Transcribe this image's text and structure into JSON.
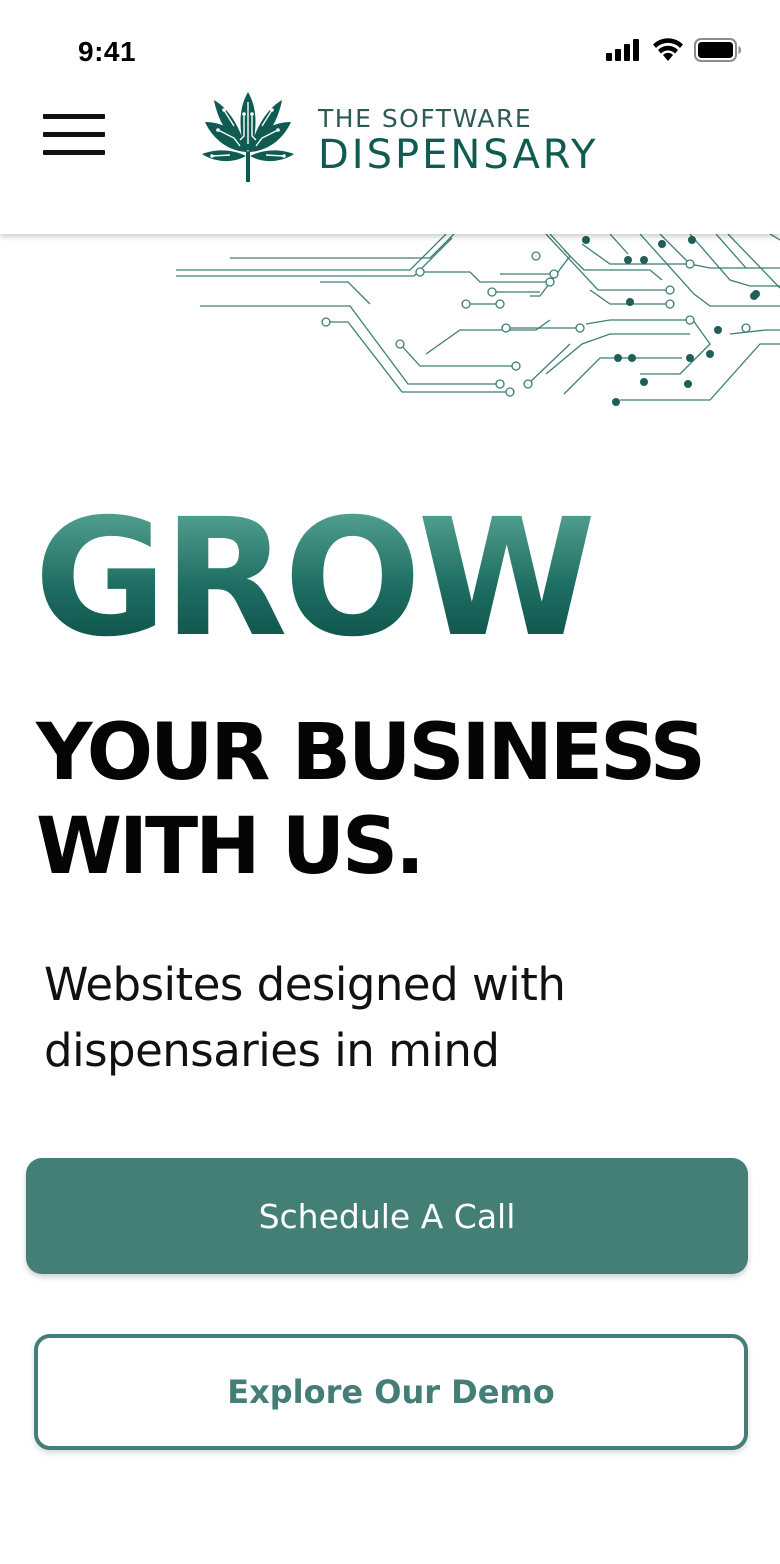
{
  "status_bar": {
    "time": "9:41"
  },
  "header": {
    "menu_icon": "hamburger-menu-icon",
    "logo_icon": "cannabis-leaf-circuit-icon",
    "logo_line1": "THE SOFTWARE",
    "logo_line2": "DISPENSARY"
  },
  "hero": {
    "decoration_icon": "circuit-lines-decoration",
    "grow": "GROW",
    "headline_line1": "YOUR BUSINESS",
    "headline_line2": "WITH US.",
    "subtitle_line1": "Websites designed with",
    "subtitle_line2": "dispensaries in mind"
  },
  "actions": {
    "primary_label": "Schedule A Call",
    "secondary_label": "Explore Our Demo"
  },
  "colors": {
    "brand": "#437e77",
    "brand_dark": "#0f5b52",
    "text": "#050505",
    "background": "#ffffff"
  }
}
